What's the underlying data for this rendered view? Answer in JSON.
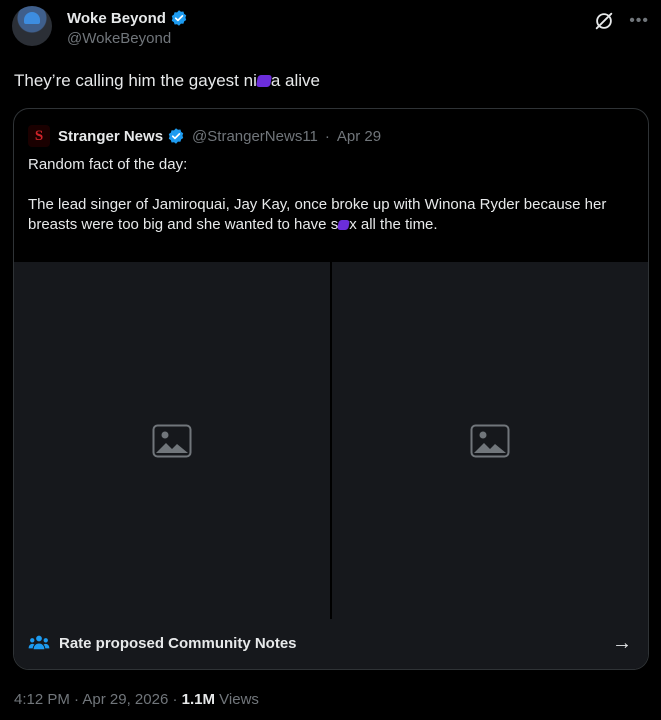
{
  "author": {
    "display_name": "Woke Beyond",
    "handle": "@WokeBeyond",
    "verified": true,
    "avatar_icon": "avatar-photo"
  },
  "post": {
    "text_before": "They’re calling him the gayest ni",
    "text_after": "a alive"
  },
  "quoted": {
    "display_name": "Stranger News",
    "handle": "@StrangerNews11",
    "date": "Apr 29",
    "separator": "·",
    "verified": true,
    "line1": "Random fact of the day:",
    "line2_before": "The lead singer of Jamiroquai, Jay Kay, once broke up with Winona Ryder because her breasts were too big and she wanted to have s",
    "line2_after": "x all the time.",
    "media": [
      {
        "placeholder_icon": "image-icon"
      },
      {
        "placeholder_icon": "image-icon"
      }
    ]
  },
  "community_notes": {
    "label": "Rate proposed Community Notes",
    "icon": "people-icon",
    "arrow": "→"
  },
  "footer": {
    "time": "4:12 PM",
    "date": "Apr 29, 2026",
    "separator": "·",
    "views_count": "1.1M",
    "views_label": "Views"
  },
  "colors": {
    "background": "#000000",
    "primary_text": "#e7e9ea",
    "secondary_text": "#71767b",
    "verified": "#1d9bf0",
    "redaction": "#6b2ddb",
    "border": "#2f3336"
  }
}
